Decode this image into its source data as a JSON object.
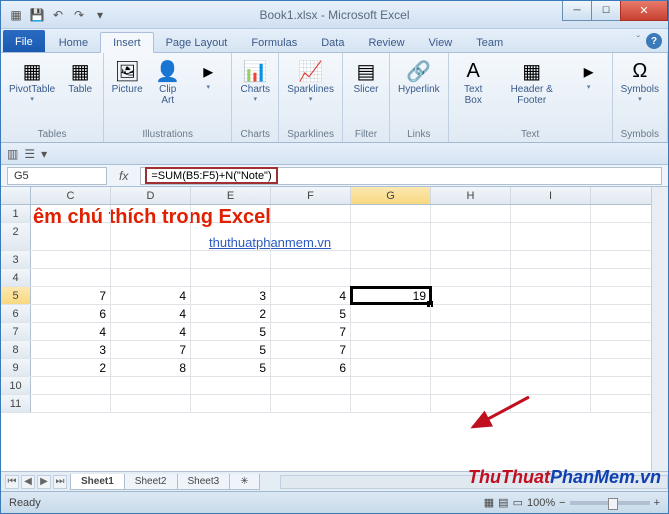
{
  "titlebar": {
    "title": "Book1.xlsx - Microsoft Excel"
  },
  "tabs": {
    "file": "File",
    "list": [
      "Home",
      "Insert",
      "Page Layout",
      "Formulas",
      "Data",
      "Review",
      "View",
      "Team"
    ],
    "active": "Insert"
  },
  "ribbon": {
    "groups": [
      {
        "label": "Tables",
        "items": [
          {
            "name": "pivottable",
            "label": "PivotTable",
            "dd": true
          },
          {
            "name": "table",
            "label": "Table"
          }
        ]
      },
      {
        "label": "Illustrations",
        "items": [
          {
            "name": "picture",
            "label": "Picture"
          },
          {
            "name": "clipart",
            "label": "Clip\nArt"
          },
          {
            "name": "shapes-more",
            "label": "",
            "dd": true
          }
        ]
      },
      {
        "label": "Charts",
        "items": [
          {
            "name": "charts",
            "label": "Charts",
            "dd": true
          }
        ]
      },
      {
        "label": "Sparklines",
        "items": [
          {
            "name": "sparklines",
            "label": "Sparklines",
            "dd": true
          }
        ]
      },
      {
        "label": "Filter",
        "items": [
          {
            "name": "slicer",
            "label": "Slicer"
          }
        ]
      },
      {
        "label": "Links",
        "items": [
          {
            "name": "hyperlink",
            "label": "Hyperlink"
          }
        ]
      },
      {
        "label": "Text",
        "items": [
          {
            "name": "textbox",
            "label": "Text\nBox"
          },
          {
            "name": "headerfooter",
            "label": "Header\n& Footer"
          },
          {
            "name": "text-more",
            "label": "",
            "dd": true
          }
        ]
      },
      {
        "label": "Symbols",
        "items": [
          {
            "name": "symbols",
            "label": "Symbols",
            "dd": true
          }
        ]
      }
    ]
  },
  "namebox": {
    "value": "G5"
  },
  "formula": {
    "value": "=SUM(B5:F5)+N(\"Note\")"
  },
  "columns": [
    "C",
    "D",
    "E",
    "F",
    "G",
    "H",
    "I"
  ],
  "row_numbers": [
    1,
    2,
    3,
    4,
    5,
    6,
    7,
    8,
    9,
    10,
    11
  ],
  "title_text": "êm chú thích trong Excel",
  "link_text": "thuthuatphanmem.vn",
  "grid": {
    "5": {
      "C": "7",
      "D": "4",
      "E": "3",
      "F": "4",
      "G": "19"
    },
    "6": {
      "C": "6",
      "D": "4",
      "E": "2",
      "F": "5"
    },
    "7": {
      "C": "4",
      "D": "4",
      "E": "5",
      "F": "7"
    },
    "8": {
      "C": "3",
      "D": "7",
      "E": "5",
      "F": "7"
    },
    "9": {
      "C": "2",
      "D": "8",
      "E": "5",
      "F": "6"
    }
  },
  "selected": {
    "row": 5,
    "col": "G"
  },
  "sheets": {
    "list": [
      "Sheet1",
      "Sheet2",
      "Sheet3"
    ],
    "active": "Sheet1"
  },
  "status": {
    "left": "Ready",
    "zoom": "100%"
  },
  "watermark": {
    "a": "ThuThuat",
    "b": "PhanMem",
    "c": ".vn"
  },
  "chart_data": {
    "type": "table",
    "title": "êm chú thích trong Excel",
    "columns": [
      "C",
      "D",
      "E",
      "F",
      "G"
    ],
    "rows": [
      {
        "row": 5,
        "C": 7,
        "D": 4,
        "E": 3,
        "F": 4,
        "G": 19
      },
      {
        "row": 6,
        "C": 6,
        "D": 4,
        "E": 2,
        "F": 5,
        "G": null
      },
      {
        "row": 7,
        "C": 4,
        "D": 4,
        "E": 5,
        "F": 7,
        "G": null
      },
      {
        "row": 8,
        "C": 3,
        "D": 7,
        "E": 5,
        "F": 7,
        "G": null
      },
      {
        "row": 9,
        "C": 2,
        "D": 8,
        "E": 5,
        "F": 6,
        "G": null
      }
    ],
    "formula": "=SUM(B5:F5)+N(\"Note\")",
    "active_cell": "G5"
  }
}
